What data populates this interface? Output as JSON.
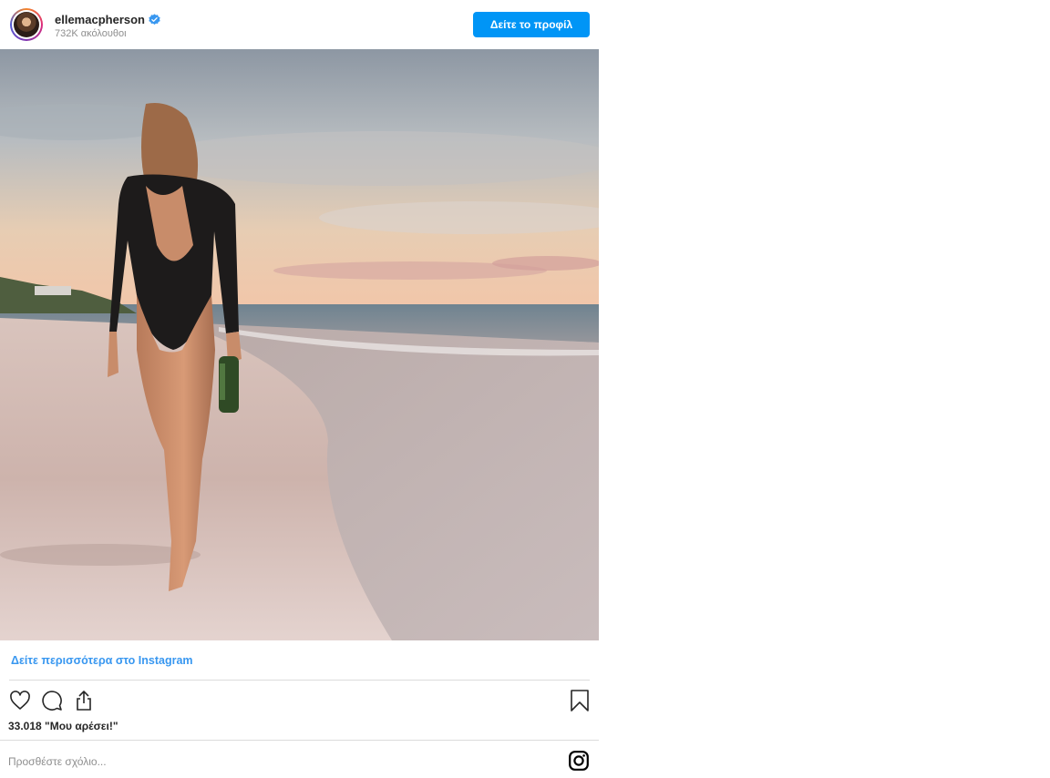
{
  "header": {
    "username": "ellemacpherson",
    "verified": true,
    "followers": "732K ακόλουθοι",
    "profile_button": "Δείτε το προφίλ"
  },
  "post": {
    "photo_icon": "photo-beach-woman-walking"
  },
  "footer": {
    "see_more": "Δείτε περισσότερα στο Instagram",
    "likes": "33.018 \"Μου αρέσει!\"",
    "comment_placeholder": "Προσθέστε σχόλιο...",
    "icons": [
      "heart-icon",
      "comment-icon",
      "share-icon",
      "bookmark-icon",
      "instagram-logo-icon"
    ]
  },
  "colors": {
    "accent": "#0095f6",
    "link": "#3897f0",
    "text": "#262626",
    "muted": "#8e8e8e",
    "divider": "#dbdbdb"
  }
}
